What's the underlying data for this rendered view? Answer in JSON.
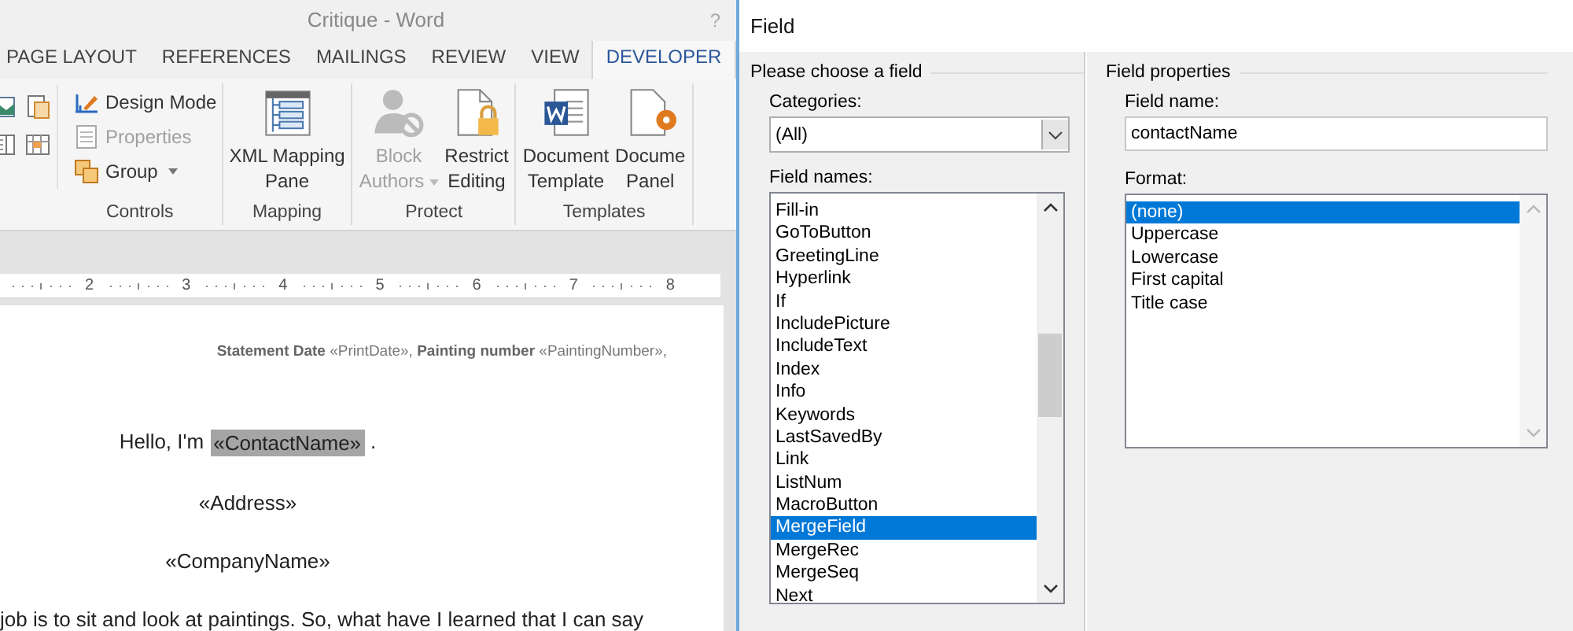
{
  "window": {
    "title": "Critique - Word",
    "help": "?"
  },
  "tabs": [
    {
      "label": "PAGE LAYOUT",
      "selected": false
    },
    {
      "label": "REFERENCES",
      "selected": false
    },
    {
      "label": "MAILINGS",
      "selected": false
    },
    {
      "label": "REVIEW",
      "selected": false
    },
    {
      "label": "VIEW",
      "selected": false
    },
    {
      "label": "DEVELOPER",
      "selected": true
    }
  ],
  "ribbon": {
    "groups": [
      {
        "label": "Controls",
        "buttons": [
          {
            "kind": "small",
            "lines": [
              "Design Mode"
            ],
            "disabled": false,
            "dropdown": false
          },
          {
            "kind": "small",
            "lines": [
              "Properties"
            ],
            "disabled": true,
            "dropdown": false
          },
          {
            "kind": "small",
            "lines": [
              "Group"
            ],
            "disabled": false,
            "dropdown": true
          }
        ]
      },
      {
        "label": "Mapping",
        "buttons": [
          {
            "kind": "large",
            "lines": [
              "XML Mapping",
              "Pane"
            ],
            "disabled": false,
            "dropdown": false
          }
        ]
      },
      {
        "label": "Protect",
        "buttons": [
          {
            "kind": "large",
            "lines": [
              "Block",
              "Authors"
            ],
            "disabled": true,
            "dropdown": true
          },
          {
            "kind": "large",
            "lines": [
              "Restrict",
              "Editing"
            ],
            "disabled": false,
            "dropdown": false
          }
        ]
      },
      {
        "label": "Templates",
        "buttons": [
          {
            "kind": "large",
            "lines": [
              "Document",
              "Template"
            ],
            "disabled": false,
            "dropdown": false
          },
          {
            "kind": "large",
            "lines": [
              "Docume",
              "Panel"
            ],
            "disabled": false,
            "dropdown": false
          }
        ]
      }
    ]
  },
  "ruler": {
    "numbers": [
      "2",
      "3",
      "4",
      "5",
      "6",
      "7",
      "8"
    ]
  },
  "document": {
    "lines": [
      {
        "kind": "header",
        "text": "**Statement Date** «PrintDate», **Painting number** «PaintingNumber»,"
      },
      {
        "kind": "greeting",
        "before": "Hello, I'm",
        "field": "«ContactName»",
        "field_selected": true,
        "after": "."
      },
      {
        "kind": "center",
        "text": "«Address»"
      },
      {
        "kind": "center",
        "text": "«CompanyName»"
      },
      {
        "kind": "body",
        "text": "job is to sit and look at paintings. So, what have I learned that I can say"
      }
    ]
  },
  "dialog": {
    "title": "Field",
    "left": {
      "heading": "Please choose a field",
      "categories_label": "Categories:",
      "categories_value": "(All)",
      "names_label": "Field names:",
      "names": [
        {
          "label": "Fill-in",
          "selected": false
        },
        {
          "label": "GoToButton",
          "selected": false
        },
        {
          "label": "GreetingLine",
          "selected": false
        },
        {
          "label": "Hyperlink",
          "selected": false
        },
        {
          "label": "If",
          "selected": false
        },
        {
          "label": "IncludePicture",
          "selected": false
        },
        {
          "label": "IncludeText",
          "selected": false
        },
        {
          "label": "Index",
          "selected": false
        },
        {
          "label": "Info",
          "selected": false
        },
        {
          "label": "Keywords",
          "selected": false
        },
        {
          "label": "LastSavedBy",
          "selected": false
        },
        {
          "label": "Link",
          "selected": false
        },
        {
          "label": "ListNum",
          "selected": false
        },
        {
          "label": "MacroButton",
          "selected": false
        },
        {
          "label": "MergeField",
          "selected": true
        },
        {
          "label": "MergeRec",
          "selected": false
        },
        {
          "label": "MergeSeq",
          "selected": false
        },
        {
          "label": "Next",
          "selected": false
        }
      ]
    },
    "right": {
      "heading": "Field properties",
      "name_label": "Field name:",
      "name_value": "contactName",
      "format_label": "Format:",
      "formats": [
        {
          "label": "(none)",
          "selected": true
        },
        {
          "label": "Uppercase",
          "selected": false
        },
        {
          "label": "Lowercase",
          "selected": false
        },
        {
          "label": "First capital",
          "selected": false
        },
        {
          "label": "Title case",
          "selected": false
        }
      ]
    }
  }
}
